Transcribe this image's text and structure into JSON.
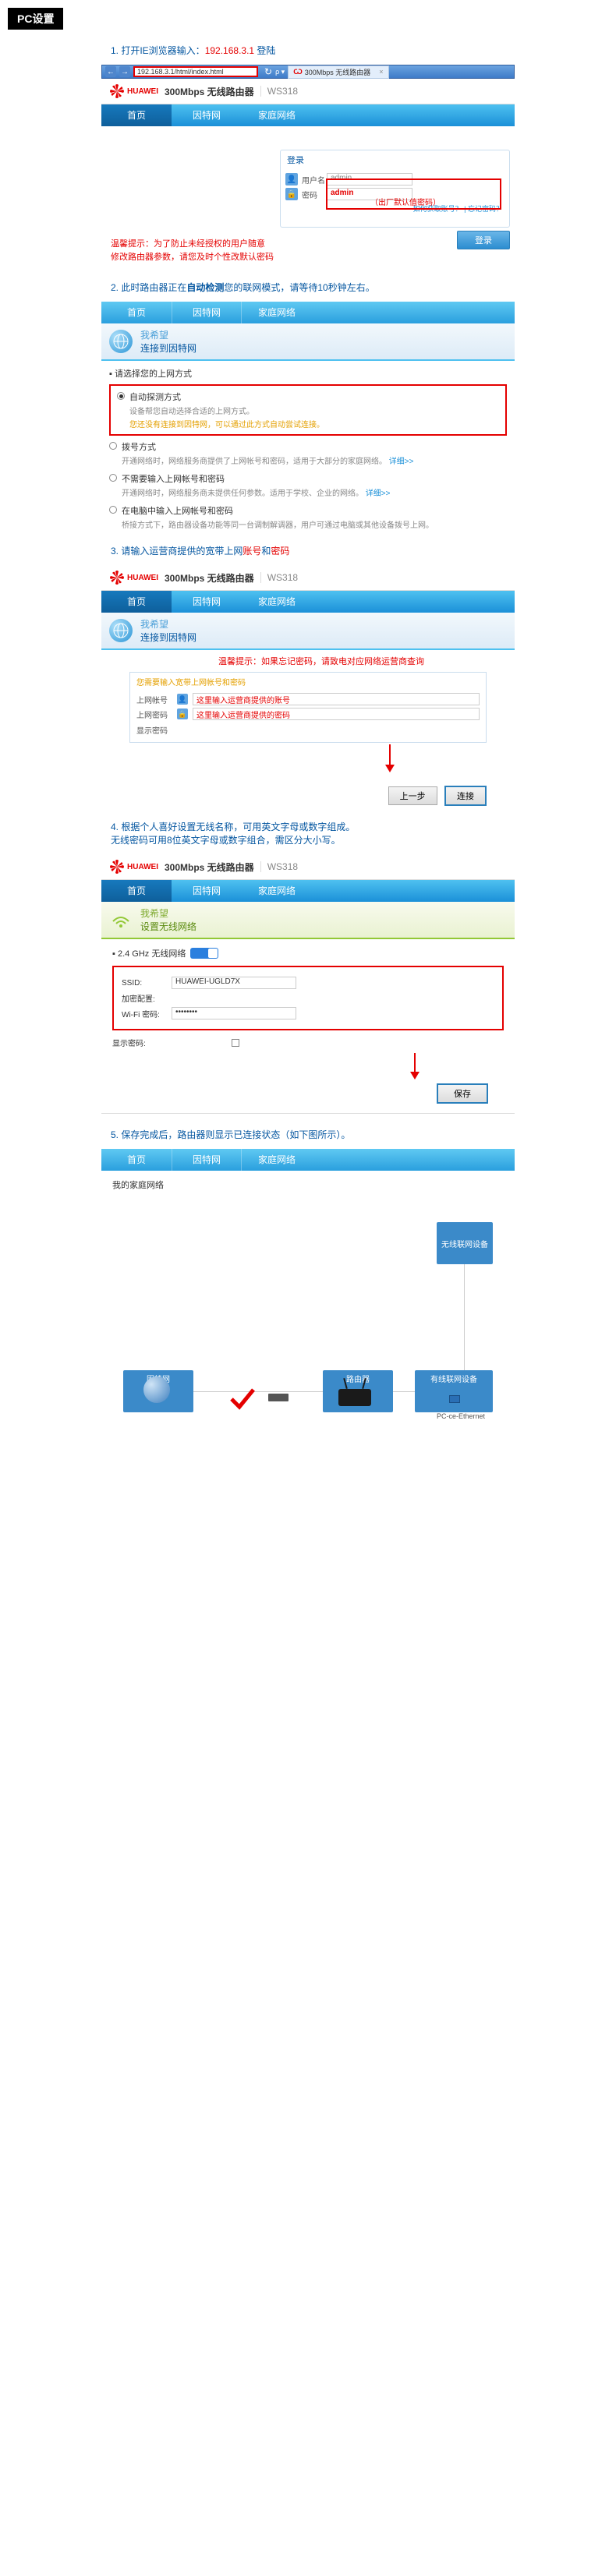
{
  "badge": "PC设置",
  "steps": {
    "s1_pre": "1. 打开IE浏览器输入：",
    "s1_ip": "192.168.3.1",
    "s1_suf": " 登陆",
    "s2_a": "2. 此时路由器正在",
    "s2_b": "自动检测",
    "s2_c": "您的联网模式，请等待10秒钟左右。",
    "s3_a": "3. 请输入运营商提供的宽带上网",
    "s3_b": "账号",
    "s3_c": "和",
    "s3_d": "密码",
    "s4": "4. 根据个人喜好设置无线名称，可用英文字母或数字组成。\n无线密码可用8位英文字母或数字组合，需区分大小写。",
    "s5": "5. 保存完成后，路由器则显示已连接状态（如下图所示）。"
  },
  "ie": {
    "url": "192.168.3.1/html/index.html",
    "refresh": "↻",
    "search": "ρ ▾",
    "tab_brand": "Ѡ",
    "tab_text": "300Mbps 无线路由器",
    "tab_close": "×"
  },
  "router": {
    "brand": "HUAWEI",
    "title": "300Mbps 无线路由器",
    "model": "WS318"
  },
  "nav": {
    "home": "首页",
    "internet": "因特网",
    "lan": "家庭网络"
  },
  "login": {
    "title": "登录",
    "user_lbl": "用户名",
    "user_val": "admin",
    "pass_lbl": "密码",
    "pass_val": "admin",
    "hint": "（出厂默认值密码）",
    "links": "如何获取账号？ | 忘记密码？",
    "btn": "登录"
  },
  "warm": "温馨提示：为了防止未经授权的用户随意\n修改路由器参数，请您及时个性改默认密码",
  "wish": {
    "l1": "我希望",
    "l2": "连接到因特网"
  },
  "conn": {
    "head": "▪ 请选择您的上网方式",
    "o1_t": "自动探测方式",
    "o1_d1": "设备帮您自动选择合适的上网方式。",
    "o1_d2": "您还没有连接到因特网，可以通过此方式自动尝试连接。",
    "o2_t": "拨号方式",
    "o2_d": "开通网络时，网络服务商提供了上网帐号和密码，适用于大部分的家庭网络。",
    "o3_t": "不需要输入上网帐号和密码",
    "o3_d": "开通网络时，网络服务商未提供任何参数。适用于学校、企业的网络。",
    "o4_t": "在电脑中输入上网帐号和密码",
    "o4_d": "桥接方式下，路由器设备功能等同一台调制解调器，用户可通过电脑或其他设备拨号上网。"
  },
  "redtip": "温馨提示：如果忘记密码，请致电对应网络运营商查询",
  "creds": {
    "head": "您需要输入宽带上网帐号和密码",
    "acc_lbl": "上网帐号",
    "acc_ph": "这里输入运营商提供的账号",
    "pwd_lbl": "上网密码",
    "pwd_ph": "这里输入运营商提供的密码",
    "show": "显示密码",
    "back": "上一步",
    "connect": "连接"
  },
  "wlan": {
    "l1": "我希望",
    "l2": "设置无线网络",
    "band": "▪ 2.4 GHz 无线网络",
    "ssid_lbl": "SSID:",
    "ssid_val": "HUAWEI-UGLD7X",
    "enc_lbl": "加密配置:",
    "pwd_lbl": "Wi-Fi 密码:",
    "pwd_val": "••••••••",
    "show": "显示密码:",
    "save": "保存"
  },
  "diag": {
    "wireless": "无线联网设备",
    "internet": "因特网",
    "router": "路由器",
    "wired": "有线联网设备",
    "pc": "PC-ce-Ethernet",
    "home": "我的家庭网络"
  }
}
